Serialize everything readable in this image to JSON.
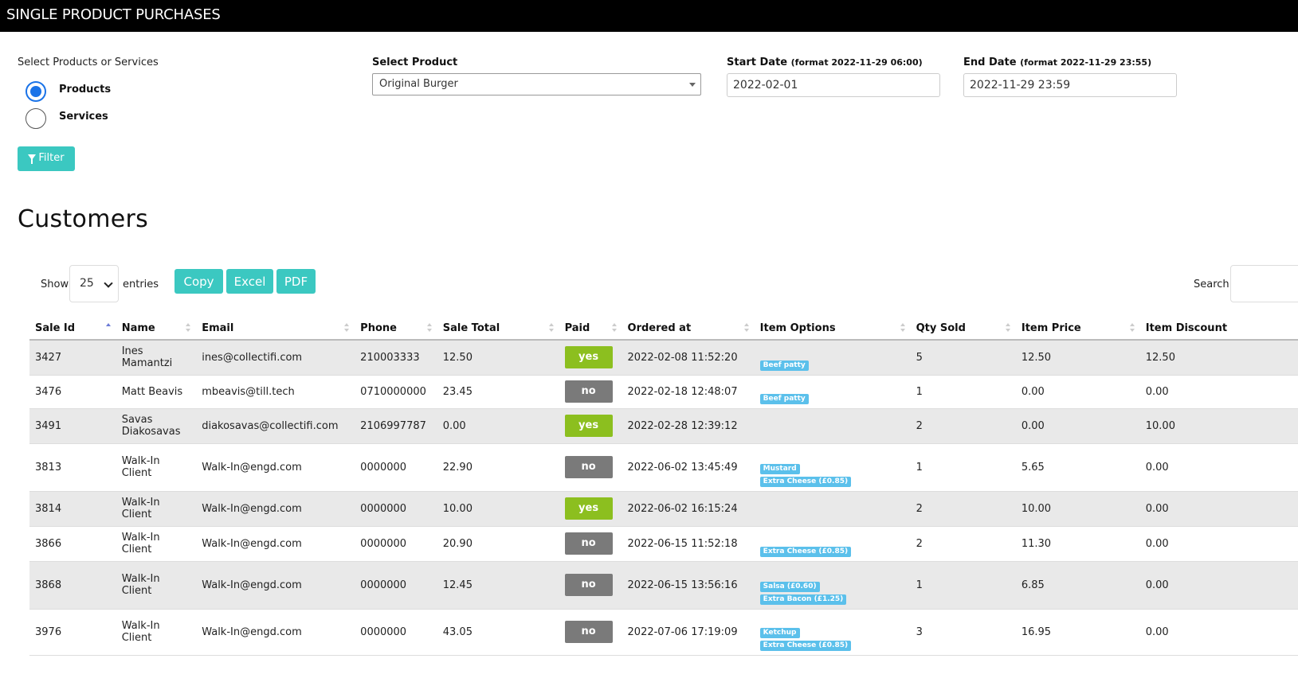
{
  "header": {
    "title": "SINGLE PRODUCT PURCHASES"
  },
  "filters": {
    "type_label": "Select Products or Services",
    "options": [
      {
        "label": "Products",
        "checked": true
      },
      {
        "label": "Services",
        "checked": false
      }
    ],
    "product_label": "Select Product",
    "product_value": "Original Burger",
    "start_label": "Start Date",
    "start_hint": "(format 2022-11-29 06:00)",
    "start_value": "2022-02-01",
    "end_label": "End Date",
    "end_hint": "(format 2022-11-29 23:55)",
    "end_value": "2022-11-29 23:59",
    "filter_button": "Filter"
  },
  "section": {
    "title": "Customers"
  },
  "table_controls": {
    "show_label": "Show",
    "entries_value": "25",
    "entries_label": "entries",
    "copy": "Copy",
    "excel": "Excel",
    "pdf": "PDF",
    "search_label": "Search:"
  },
  "columns": [
    "Sale Id",
    "Name",
    "Email",
    "Phone",
    "Sale Total",
    "Paid",
    "Ordered at",
    "Item Options",
    "Qty Sold",
    "Item Price",
    "Item Discount"
  ],
  "rows": [
    {
      "sale_id": "3427",
      "name": "Ines Mamantzi",
      "email": "ines@collectifi.com",
      "phone": "210003333",
      "total": "12.50",
      "paid": "yes",
      "ordered": "2022-02-08 11:52:20",
      "options": [
        "Beef patty"
      ],
      "qty": "5",
      "price": "12.50",
      "discount": "12.50"
    },
    {
      "sale_id": "3476",
      "name": "Matt Beavis",
      "email": "mbeavis@till.tech",
      "phone": "0710000000",
      "total": "23.45",
      "paid": "no",
      "ordered": "2022-02-18 12:48:07",
      "options": [
        "Beef patty"
      ],
      "qty": "1",
      "price": "0.00",
      "discount": "0.00"
    },
    {
      "sale_id": "3491",
      "name": "Savas Diakosavas",
      "email": "diakosavas@collectifi.com",
      "phone": "2106997787",
      "total": "0.00",
      "paid": "yes",
      "ordered": "2022-02-28 12:39:12",
      "options": [],
      "qty": "2",
      "price": "0.00",
      "discount": "10.00"
    },
    {
      "sale_id": "3813",
      "name": "Walk-In Client",
      "email": "Walk-In@engd.com",
      "phone": "0000000",
      "total": "22.90",
      "paid": "no",
      "ordered": "2022-06-02 13:45:49",
      "options": [
        "Mustard",
        "Extra Cheese (£0.85)"
      ],
      "qty": "1",
      "price": "5.65",
      "discount": "0.00"
    },
    {
      "sale_id": "3814",
      "name": "Walk-In Client",
      "email": "Walk-In@engd.com",
      "phone": "0000000",
      "total": "10.00",
      "paid": "yes",
      "ordered": "2022-06-02 16:15:24",
      "options": [],
      "qty": "2",
      "price": "10.00",
      "discount": "0.00"
    },
    {
      "sale_id": "3866",
      "name": "Walk-In Client",
      "email": "Walk-In@engd.com",
      "phone": "0000000",
      "total": "20.90",
      "paid": "no",
      "ordered": "2022-06-15 11:52:18",
      "options": [
        "Extra Cheese (£0.85)"
      ],
      "qty": "2",
      "price": "11.30",
      "discount": "0.00"
    },
    {
      "sale_id": "3868",
      "name": "Walk-In Client",
      "email": "Walk-In@engd.com",
      "phone": "0000000",
      "total": "12.45",
      "paid": "no",
      "ordered": "2022-06-15 13:56:16",
      "options": [
        "Salsa (£0.60)",
        "Extra Bacon (£1.25)"
      ],
      "qty": "1",
      "price": "6.85",
      "discount": "0.00"
    },
    {
      "sale_id": "3976",
      "name": "Walk-In Client",
      "email": "Walk-In@engd.com",
      "phone": "0000000",
      "total": "43.05",
      "paid": "no",
      "ordered": "2022-07-06 17:19:09",
      "options": [
        "Ketchup",
        "Extra Cheese (£0.85)"
      ],
      "qty": "3",
      "price": "16.95",
      "discount": "0.00"
    }
  ],
  "colors": {
    "teal": "#3bc8c1",
    "paid_yes": "#8cbf1f",
    "paid_no": "#7a7a7a",
    "option_badge": "#5bc0eb",
    "radio_checked": "#1a73e8"
  }
}
